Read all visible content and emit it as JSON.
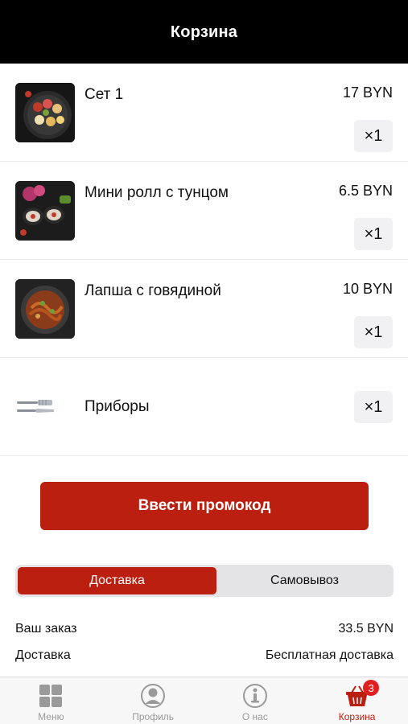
{
  "header": {
    "title": "Корзина"
  },
  "cart": {
    "items": [
      {
        "name": "Сет 1",
        "price": "17 BYN",
        "quantity": "×1",
        "image": "sushi-set-photo"
      },
      {
        "name": "Мини ролл с тунцом",
        "price": "6.5 BYN",
        "quantity": "×1",
        "image": "tuna-roll-photo"
      },
      {
        "name": "Лапша с говядиной",
        "price": "10 BYN",
        "quantity": "×1",
        "image": "beef-noodles-photo"
      }
    ],
    "cutlery": {
      "name": "Приборы",
      "quantity": "×1",
      "icon": "cutlery-icon"
    }
  },
  "promo": {
    "label": "Ввести промокод"
  },
  "delivery_toggle": {
    "options": [
      "Доставка",
      "Самовывоз"
    ],
    "selected": "Доставка"
  },
  "summary": {
    "order_label": "Ваш заказ",
    "order_value": "33.5 BYN",
    "delivery_label": "Доставка",
    "delivery_value": "Бесплатная доставка"
  },
  "tabbar": {
    "tabs": [
      {
        "label": "Меню",
        "icon": "grid-icon"
      },
      {
        "label": "Профиль",
        "icon": "profile-icon"
      },
      {
        "label": "О нас",
        "icon": "info-icon"
      },
      {
        "label": "Корзина",
        "icon": "basket-icon",
        "badge": "3",
        "active": true
      }
    ]
  },
  "colors": {
    "accent": "#bb1f10",
    "header": "#000000",
    "badge": "#e02020"
  }
}
